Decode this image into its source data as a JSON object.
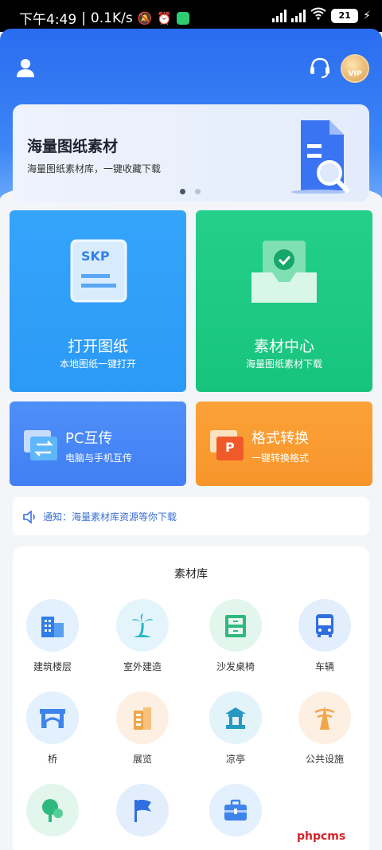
{
  "status_bar": {
    "time": "下午4:49",
    "separator": "|",
    "speed": "0.1K/s",
    "battery": "21"
  },
  "header": {
    "icons": [
      "user-icon",
      "headset-icon",
      "vip-badge"
    ],
    "vip_label": "VIP"
  },
  "banner": {
    "title": "海量图纸素材",
    "subtitle": "海量图纸素材库，一键收藏下载",
    "page_count": 2,
    "active_page": 1
  },
  "cards": {
    "open": {
      "title": "打开图纸",
      "subtitle": "本地图纸一键打开",
      "icon_text": "SKP",
      "color": "#2b9af7"
    },
    "material": {
      "title": "素材中心",
      "subtitle": "海量图纸素材下载",
      "color": "#17c47d"
    },
    "pc": {
      "title": "PC互传",
      "subtitle": "电脑与手机互传",
      "color": "#417ff3"
    },
    "format": {
      "title": "格式转换",
      "subtitle": "一键转换格式",
      "icon_text": "P",
      "color": "#f8952b"
    }
  },
  "notice": {
    "text": "通知：海量素材库资源等你下载"
  },
  "library": {
    "title": "素材库",
    "items": [
      {
        "label": "建筑楼层",
        "icon": "building-icon"
      },
      {
        "label": "室外建造",
        "icon": "palm-tree-icon"
      },
      {
        "label": "沙发桌椅",
        "icon": "cabinet-icon"
      },
      {
        "label": "车辆",
        "icon": "bus-icon"
      },
      {
        "label": "桥",
        "icon": "bridge-icon"
      },
      {
        "label": "展览",
        "icon": "exhibition-icon"
      },
      {
        "label": "凉亭",
        "icon": "pavilion-icon"
      },
      {
        "label": "公共设施",
        "icon": "tower-icon"
      },
      {
        "label": "",
        "icon": "tree-icon"
      },
      {
        "label": "",
        "icon": "flag-icon"
      },
      {
        "label": "",
        "icon": "briefcase-icon"
      }
    ]
  },
  "watermark": "phpcms"
}
